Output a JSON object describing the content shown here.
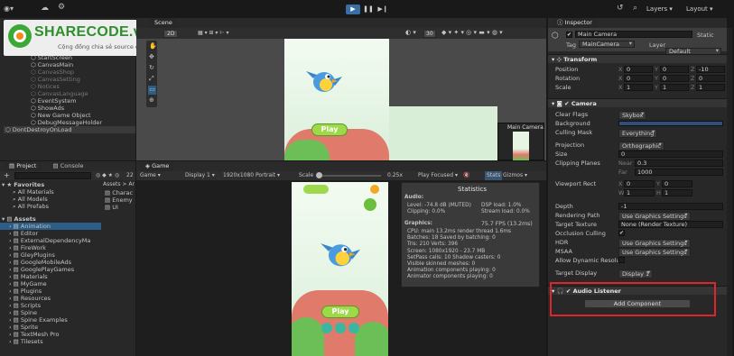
{
  "toolbar": {
    "account_icon": "account-dropdown-icon",
    "cloud_icon": "cloud-icon",
    "collab_icon": "collab-icon",
    "history_icon": "history-icon",
    "search_icon": "search-icon",
    "layers_label": "Layers",
    "layout_label": "Layout"
  },
  "watermark": {
    "brand": "SHARECODE.vn",
    "tagline": "Cộng đồng chia sẻ source code"
  },
  "hierarchy": {
    "items": [
      {
        "label": "StartScreen",
        "dim": false
      },
      {
        "label": "CanvasMain",
        "dim": false
      },
      {
        "label": "CanvasShop",
        "dim": true
      },
      {
        "label": "CanvasSetting",
        "dim": true
      },
      {
        "label": "Notices",
        "dim": true
      },
      {
        "label": "CanvasLanguage",
        "dim": true
      },
      {
        "label": "EventSystem",
        "dim": false
      },
      {
        "label": "ShowAds",
        "dim": false
      },
      {
        "label": "New Game Object",
        "dim": false
      },
      {
        "label": "DebugMessageHolder",
        "dim": false
      },
      {
        "label": "DontDestroyOnLoad",
        "dim": false
      }
    ]
  },
  "scene": {
    "tab_label": "Scene",
    "mode_2d": "2D",
    "scene_count": "30",
    "play_label": "Play",
    "camera_preview_label": "Main Camera"
  },
  "project": {
    "tabs": [
      "Project",
      "Console"
    ],
    "add_label": "+",
    "count": "22",
    "favorites_label": "Favorites",
    "favorites": [
      "All Materials",
      "All Models",
      "All Prefabs"
    ],
    "assets_label": "Assets",
    "assets": [
      "Animation",
      "Editor",
      "ExternalDependencyMa",
      "FireWork",
      "GleyPlugins",
      "GoogleMobileAds",
      "GooglePlayGames",
      "Materials",
      "MyGame",
      "Plugins",
      "Resources",
      "Scripts",
      "Spine",
      "Spine Examples",
      "Sprite",
      "TextMesh Pro",
      "Tilesets"
    ],
    "breadcrumb": "Assets > Ar",
    "files": [
      "Charac",
      "Enemy",
      "UI"
    ]
  },
  "game": {
    "tab_label": "Game",
    "view_select": "Game",
    "display_select": "Display 1",
    "resolution_select": "1920x1080 Portrait",
    "scale_label": "Scale",
    "scale_value": "0.25x",
    "play_focused": "Play Focused",
    "stats_label": "Stats",
    "gizmos_label": "Gizmos",
    "play_label": "Play"
  },
  "statistics": {
    "title": "Statistics",
    "audio_label": "Audio:",
    "level": "Level: -74.8 dB (MUTED)",
    "clipping": "Clipping: 0.0%",
    "dsp": "DSP load: 1.0%",
    "stream": "Stream load: 0.0%",
    "graphics_label": "Graphics:",
    "fps": "75.7 FPS (13.2ms)",
    "lines": [
      "CPU: main 13.2ms  render thread 1.6ms",
      "Batches: 18    Saved by batching: 0",
      "Tris: 210       Verts: 396",
      "Screen: 1080x1920 - 23.7 MB",
      "SetPass calls: 10      Shadow casters: 0",
      "Visible skinned meshes: 0",
      "Animation components playing: 0",
      "Animator components playing: 0"
    ]
  },
  "inspector": {
    "tab_label": "Inspector",
    "object_name": "Main Camera",
    "static_label": "Static",
    "tag_label": "Tag",
    "tag_value": "MainCamera",
    "layer_label": "Layer",
    "layer_value": "Default",
    "transform_label": "Transform",
    "position_label": "Position",
    "rotation_label": "Rotation",
    "scale_label": "Scale",
    "position": {
      "x": "0",
      "y": "0",
      "z": "-10"
    },
    "rotation": {
      "x": "0",
      "y": "0",
      "z": "0"
    },
    "scale": {
      "x": "1",
      "y": "1",
      "z": "1"
    },
    "camera_label": "Camera",
    "clear_flags_label": "Clear Flags",
    "clear_flags_value": "Skybox",
    "background_label": "Background",
    "background_color": "#314d79",
    "culling_mask_label": "Culling Mask",
    "culling_mask_value": "Everything",
    "projection_label": "Projection",
    "projection_value": "Orthographic",
    "size_label": "Size",
    "size_value": "0",
    "clipping_label": "Clipping Planes",
    "near_label": "Near",
    "near_value": "0.3",
    "far_label": "Far",
    "far_value": "1000",
    "viewport_label": "Viewport Rect",
    "viewport": {
      "x": "0",
      "y": "0",
      "w": "1",
      "h": "1"
    },
    "depth_label": "Depth",
    "depth_value": "-1",
    "rendering_path_label": "Rendering Path",
    "rendering_path_value": "Use Graphics Settings",
    "target_texture_label": "Target Texture",
    "target_texture_value": "None (Render Texture)",
    "occlusion_label": "Occlusion Culling",
    "hdr_label": "HDR",
    "hdr_value": "Use Graphics Settings",
    "msaa_label": "MSAA",
    "msaa_value": "Use Graphics Settings",
    "dynamic_res_label": "Allow Dynamic Resolut",
    "target_display_label": "Target Display",
    "target_display_value": "Display 1",
    "audio_listener_label": "Audio Listener",
    "add_component_label": "Add Component"
  },
  "colors": {
    "highlight_box": "#e0242b",
    "selection": "#2c5d87",
    "brand_green": "#3aa935"
  }
}
